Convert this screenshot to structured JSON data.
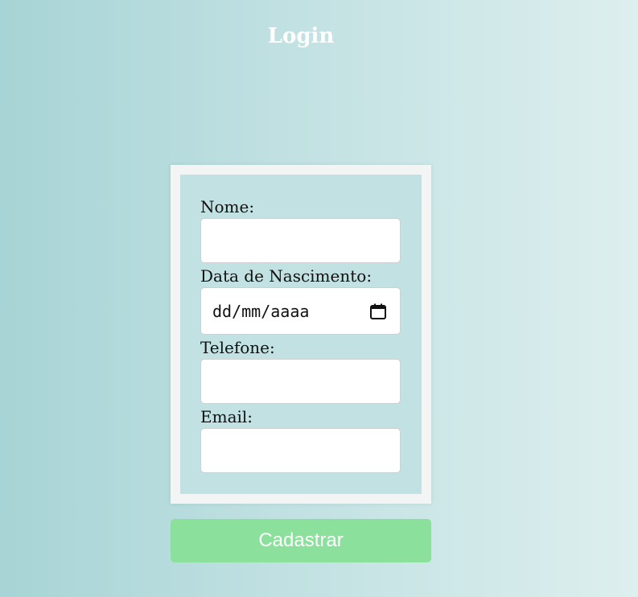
{
  "header": {
    "title": "Login"
  },
  "form": {
    "fields": [
      {
        "label": "Nome:",
        "value": ""
      },
      {
        "label": "Data de Nascimento:",
        "value": "dd/mm/aaaa"
      },
      {
        "label": "Telefone:",
        "value": ""
      },
      {
        "label": "Email:",
        "value": ""
      }
    ],
    "submit_label": "Cadastrar"
  },
  "colors": {
    "background_start": "#a7d4d6",
    "background_end": "#ddefee",
    "form_panel": "#c2e1e2",
    "form_frame": "#f3f5f5",
    "submit_button": "#8be09c"
  },
  "icons": {
    "date_picker": "calendar-icon"
  }
}
